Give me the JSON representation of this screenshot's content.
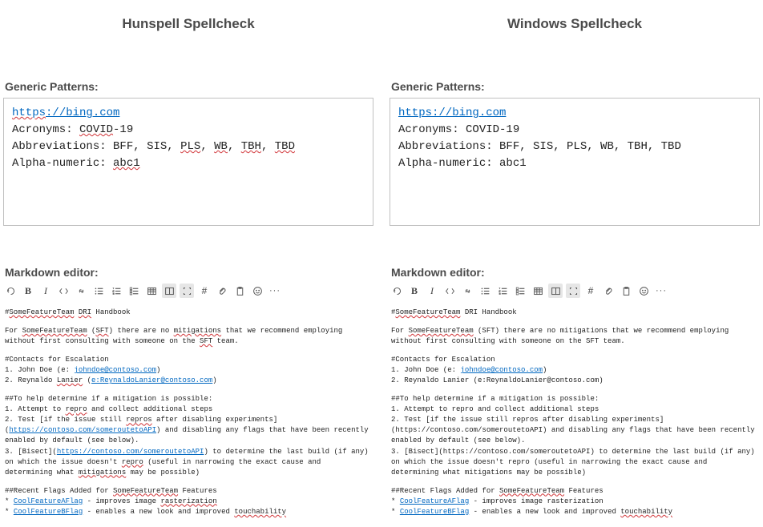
{
  "left": {
    "title": "Hunspell Spellcheck",
    "generic_label": "Generic Patterns:",
    "patterns": {
      "url_pre": "https",
      "url_rest": "://bing.com",
      "acronyms_label": "Acronyms: ",
      "covid": "COVID",
      "dash19": "-19",
      "abbrev_label": "Abbreviations: ",
      "bff": "BFF",
      "sis": "SIS",
      "pls": "PLS",
      "wb": "WB",
      "tbh": "TBH",
      "tbd": "TBD",
      "alpha_label": "Alpha-numeric: ",
      "abc1": "abc1",
      "comma": ", "
    },
    "markdown_label": "Markdown editor:",
    "md": {
      "h1_hash": "#",
      "sft": "SomeFeatureTeam",
      "dri": "DRI",
      "handbook": " Handbook",
      "for": "For ",
      "sft_abbrev": "SFT",
      "lp1": " (",
      "rp1": ") there are no ",
      "mitigations": "mitigations",
      "rest1": " that we recommend employing without first consulting with someone on the ",
      "sft2": "SFT",
      "team": " team.",
      "contacts_h": "#Contacts for Escalation",
      "john_pre": "1. John Doe (e: ",
      "john_mail": "johndoe@contoso.com",
      "john_post": ")",
      "rey_pre": "2. Reynaldo ",
      "lanier": "Lanier",
      "rey_mid": " (",
      "rey_mail": "e:ReynaldoLanier@contoso.com",
      "rey_post": ")",
      "help_h": "##To help determine if a mitigation is possible:",
      "step1a": "1. Attempt to ",
      "repro": "repro",
      "step1b": " and collect additional steps",
      "step2a": "2. Test [if the issue still ",
      "repros": "repros",
      "step2b": " after disabling experiments](",
      "route": "https://contoso.com/someroutetoAPI",
      "step2c": ") and disabling any flags that have been recently enabled by default (see below).",
      "step3a": "3. [Bisect](",
      "step3b": ") to determine the last build (if any) on which the issue doesn't ",
      "step3c": " (useful in narrowing the exact cause and determining what ",
      "step3d": " may be possible)",
      "flags_h_a": "##Recent Flags Added for ",
      "flags_h_b": " Features",
      "flagA_pre": "* ",
      "flagA": "CoolFeatureAFlag",
      "flagA_mid": " - improves image ",
      "raster": "rasterization",
      "flagB_pre": "* ",
      "flagB": "CoolFeatureBFlag",
      "flagB_mid": " - enables a new look and improved ",
      "touch": "touchability"
    }
  },
  "right": {
    "title": "Windows Spellcheck",
    "generic_label": "Generic Patterns:",
    "patterns": {
      "url": "https://bing.com",
      "acronyms": "Acronyms: COVID-19",
      "abbrev": "Abbreviations: BFF, SIS, PLS, WB, TBH, TBD",
      "alpha": "Alpha-numeric: abc1"
    },
    "markdown_label": "Markdown editor:",
    "md": {
      "h1_hash": "#",
      "sft": "SomeFeatureTeam",
      "dri_handbook": " DRI Handbook",
      "for": "For ",
      "rest1a": " (SFT) there are no mitigations that we recommend employing without first consulting with someone on the SFT team.",
      "contacts_h": "#Contacts for Escalation",
      "john_pre": "1. John Doe (e: ",
      "john_mail": "johndoe@contoso.com",
      "john_post": ")",
      "rey": "2. Reynaldo Lanier (e:ReynaldoLanier@contoso.com)",
      "help_h": "##To help determine if a mitigation is possible:",
      "step1": "1. Attempt to repro and collect additional steps",
      "step2": "2. Test [if the issue still repros after disabling experiments](https://contoso.com/someroutetoAPI) and disabling any flags that have been recently enabled by default (see below).",
      "step3": "3. [Bisect](https://contoso.com/someroutetoAPI) to determine the last build (if any) on which the issue doesn't repro (useful in narrowing the exact cause and determining what mitigations may be possible)",
      "flags_h_a": "##Recent Flags Added for ",
      "flags_h_b": " Features",
      "flagA_pre": "* ",
      "flagA": "CoolFeatureAFlag",
      "flagA_rest": " - improves image rasterization",
      "flagB_pre": "* ",
      "flagB": "CoolFeatureBFlag",
      "flagB_mid": " - enables a new look and improved ",
      "touch": "touchability"
    }
  }
}
